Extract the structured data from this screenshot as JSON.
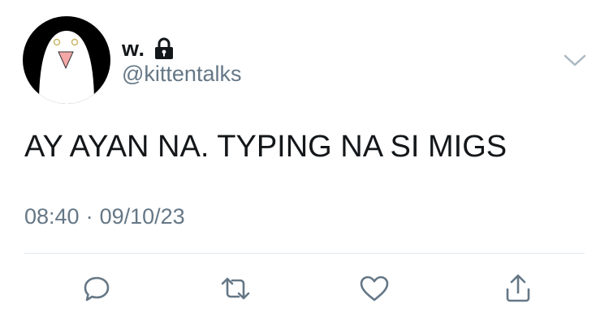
{
  "tweet": {
    "display_name": "w.",
    "handle": "@kittentalks",
    "protected_icon": "lock-icon",
    "text": "AY AYAN NA. TYPING NA SI MIGS",
    "time": "08:40",
    "separator": "·",
    "date": "09/10/23"
  },
  "actions": {
    "reply": "reply-icon",
    "retweet": "retweet-icon",
    "like": "heart-icon",
    "share": "share-icon"
  },
  "menu": "chevron-down-icon",
  "colors": {
    "text_primary": "#14171a",
    "text_secondary": "#657786",
    "icon_gray": "#657786",
    "divider": "#e1e8ed",
    "avatar_bg": "#000000",
    "avatar_face": "#ffffff",
    "avatar_beak": "#f4a7a7"
  }
}
